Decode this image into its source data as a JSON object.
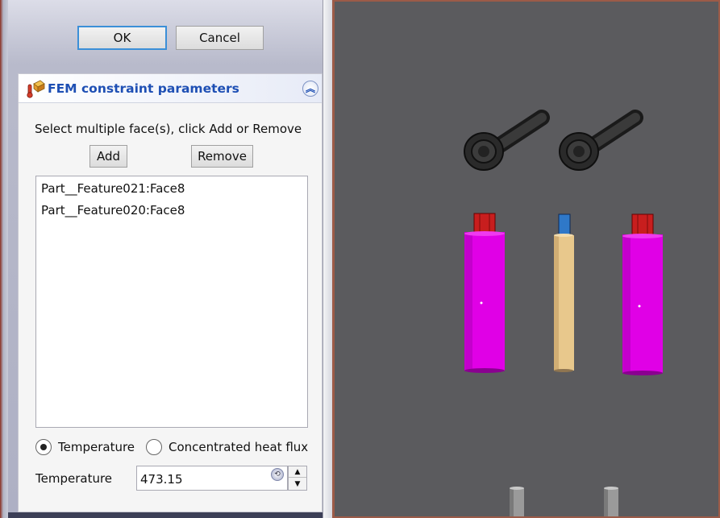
{
  "dialog": {
    "ok_label": "OK",
    "cancel_label": "Cancel"
  },
  "constraint_box": {
    "title": "FEM constraint parameters",
    "instruction": "Select multiple face(s), click Add or Remove",
    "add_label": "Add",
    "remove_label": "Remove",
    "faces": [
      "Part__Feature021:Face8",
      "Part__Feature020:Face8"
    ],
    "mode_options": [
      {
        "label": "Temperature",
        "selected": true
      },
      {
        "label": "Concentrated heat flux",
        "selected": false
      }
    ],
    "temperature_label": "Temperature",
    "temperature_value": "473.15"
  },
  "icons": {
    "header": "fem-constraint-temperature-icon",
    "collapse": "collapse-up-icon",
    "reset": "reset-field-icon",
    "spin_up": "spin-up-arrow",
    "spin_down": "spin-down-arrow"
  },
  "colors": {
    "title_blue": "#1e4fb4",
    "viewport_bg": "#5b5b5e",
    "magenta_part": "#e000e6",
    "red_face": "#c81e1e",
    "blue_face": "#2f78c8",
    "beige_part": "#e8c88c"
  }
}
